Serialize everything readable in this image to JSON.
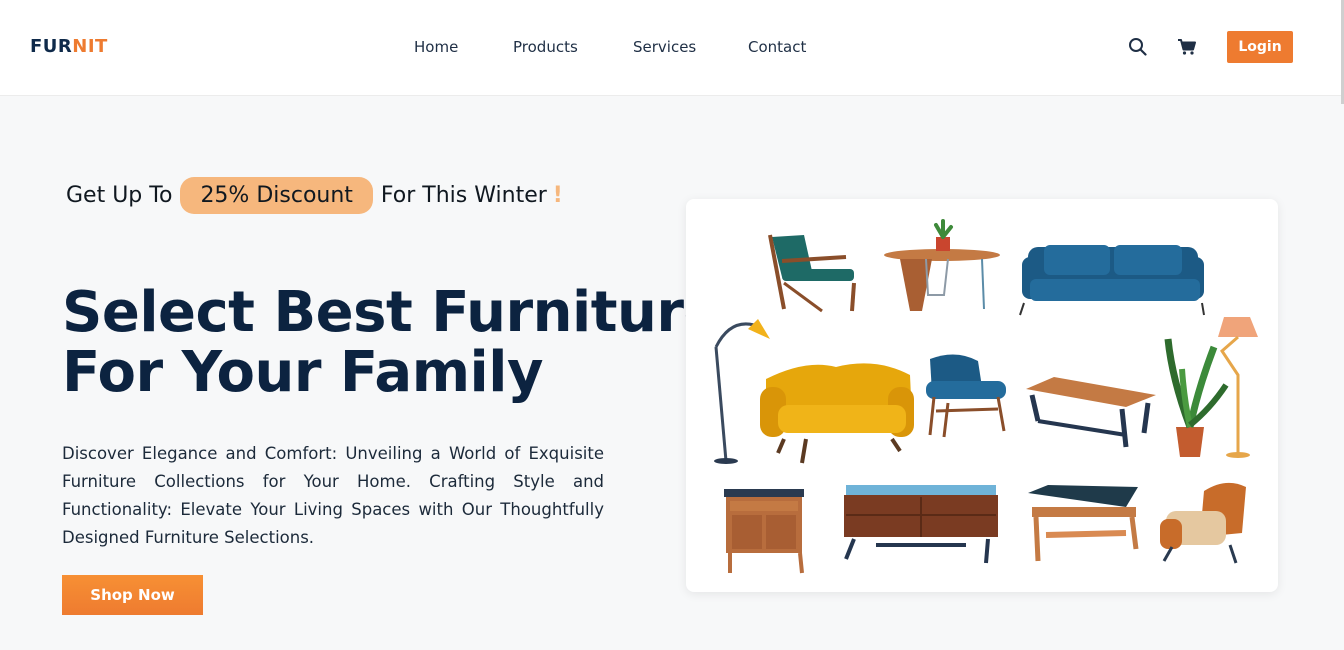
{
  "brand": {
    "part1": "FUR",
    "part2": "NIT"
  },
  "nav": [
    {
      "label": "Home"
    },
    {
      "label": "Products"
    },
    {
      "label": "Services"
    },
    {
      "label": "Contact"
    }
  ],
  "header": {
    "login_label": "Login",
    "icons": [
      "search-icon",
      "cart-icon"
    ]
  },
  "hero": {
    "promo_prefix": "Get Up To",
    "promo_highlight": "25% Discount",
    "promo_suffix": "For This Winter",
    "promo_mark": "!",
    "headline_line1": "Select Best Furniture",
    "headline_line2": "For Your Family",
    "description": "Discover Elegance and Comfort: Unveiling a World of Exquisite Furniture Collections for Your Home. Crafting Style and Functionality: Elevate Your Living Spaces with Our Thoughtfully Designed Furniture Selections.",
    "cta_label": "Shop Now"
  },
  "colors": {
    "accent": "#ee7b30",
    "pill": "#f6b77d",
    "navy": "#0c2340",
    "background": "#f7f8f9"
  }
}
